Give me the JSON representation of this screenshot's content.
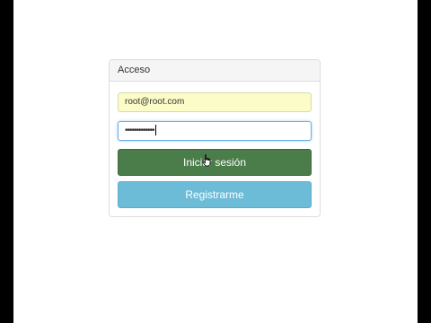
{
  "panel": {
    "title": "Acceso"
  },
  "form": {
    "email_value": "root@root.com",
    "password_mask": "•••••••••••••"
  },
  "buttons": {
    "login_label": "Iniciar sesión",
    "register_label": "Registrarme"
  },
  "colors": {
    "login_button": "#4a7d4a",
    "register_button": "#6cbcd8",
    "autofill_background": "#fbfcc7"
  },
  "icons": {
    "cursor": "hand-pointer-icon"
  }
}
